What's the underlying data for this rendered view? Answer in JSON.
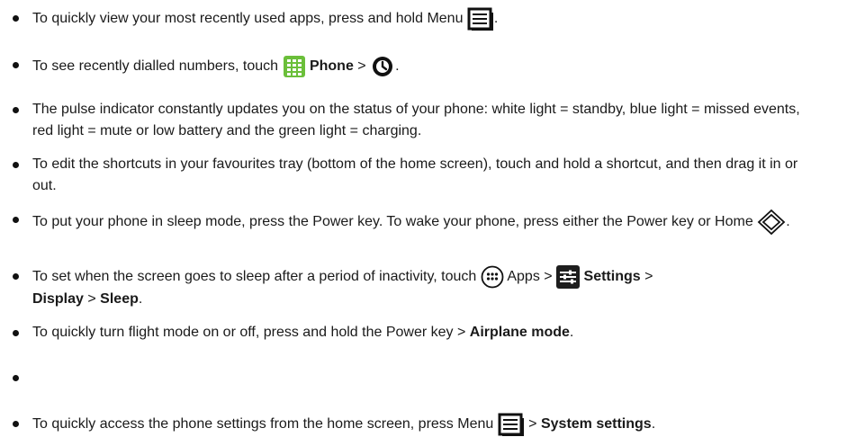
{
  "tips": [
    {
      "parts": [
        "To quickly view your most recently used apps, press and hold Menu",
        "."
      ]
    },
    {
      "parts": [
        "To see recently dialled numbers, touch",
        "Phone",
        ">",
        "."
      ]
    },
    {
      "parts": [
        "The pulse indicator constantly updates you on the status of your phone: white light = standby, blue light = missed events, red light = mute or low battery and the green light = charging."
      ]
    },
    {
      "parts": [
        "To edit the shortcuts in your favourites tray (bottom of the home screen), touch and hold a shortcut, and then drag it in or out."
      ]
    },
    {
      "parts": [
        "To put your phone in sleep mode, press the Power key. To wake your phone, press either the Power key or Home",
        "."
      ]
    },
    {
      "parts": [
        "To set when the screen goes to sleep after a period of inactivity, touch",
        "Apps >",
        "Settings",
        ">",
        "Display",
        ">",
        "Sleep",
        "."
      ]
    },
    {
      "parts": [
        "To quickly turn flight mode on or off, press and hold the Power key >",
        "Airplane mode",
        "."
      ]
    },
    {
      "parts": []
    },
    {
      "parts": [
        "To quickly access the phone settings from the home screen, press Menu",
        ">",
        "System settings",
        "."
      ]
    }
  ],
  "icons": {
    "menu": "menu-icon",
    "phone": "phone-app-icon",
    "recent": "recent-calls-icon",
    "home": "home-icon",
    "apps": "apps-icon",
    "settings": "settings-app-icon"
  }
}
